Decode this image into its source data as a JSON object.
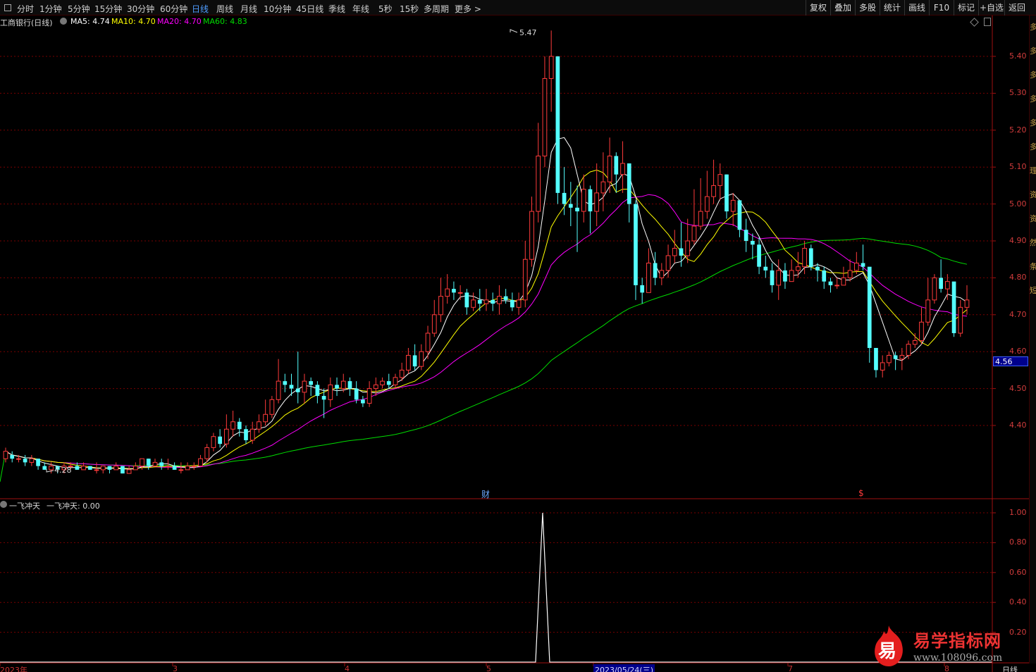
{
  "toolbar": {
    "periods": [
      {
        "label": "分时"
      },
      {
        "label": "1分钟"
      },
      {
        "label": "5分钟"
      },
      {
        "label": "15分钟"
      },
      {
        "label": "30分钟"
      },
      {
        "label": "60分钟"
      },
      {
        "label": "日线",
        "active": true
      },
      {
        "label": "周线"
      },
      {
        "label": "月线"
      },
      {
        "label": "10分钟"
      },
      {
        "label": "45日线"
      },
      {
        "label": "季线"
      },
      {
        "label": "年线"
      },
      {
        "label": "5秒"
      },
      {
        "label": "15秒"
      },
      {
        "label": "多周期"
      },
      {
        "label": "更多 >"
      }
    ],
    "right_buttons": [
      "复权",
      "叠加",
      "多股",
      "统计",
      "画线",
      "F10",
      "标记",
      "+自选",
      "返回"
    ]
  },
  "main_legend": {
    "title": "工商银行(日线)",
    "ma5": "MA5: 4.74",
    "ma10": "MA10: 4.70",
    "ma20": "MA20: 4.70",
    "ma60": "MA60: 4.83"
  },
  "indicator_legend": {
    "name": "一飞冲天",
    "value_text": "一飞冲天: 0.00"
  },
  "price_axis": [
    "5.40",
    "5.30",
    "5.20",
    "5.10",
    "5.00",
    "4.90",
    "4.80",
    "4.70",
    "4.60",
    "4.50",
    "4.40"
  ],
  "indicator_axis": [
    "1.00",
    "0.80",
    "0.60",
    "0.40",
    "0.20"
  ],
  "current_price_tag": "4.56",
  "high_marker": "5.47",
  "low_marker": "4.28",
  "event_markers": {
    "finance": "财",
    "dividend": "$"
  },
  "date_axis": [
    "2023年",
    "3",
    "4",
    "5",
    "2023/05/24(三)",
    "7",
    "8"
  ],
  "period_indicator": "日线",
  "sidebar_partial_text": "多多多多多多理资资然条短",
  "colors": {
    "up": "#ff3b3b",
    "down": "#54ffff",
    "ma5": "#ffffff",
    "ma10": "#ffff00",
    "ma20": "#ff00ff",
    "ma60": "#00dd00",
    "grid": "#7a0000",
    "axis_text": "#d23c3c"
  },
  "watermark": {
    "badge_char": "易",
    "title": "易学指标网",
    "url": "www.108096.com"
  },
  "chart_data": {
    "type": "candlestick",
    "series_names": [
      "MA5",
      "MA10",
      "MA20",
      "MA60"
    ],
    "ylim": [
      4.2,
      5.5
    ],
    "indicator_ylim": [
      0,
      1.05
    ],
    "indicator_peak": 1.0,
    "candles": [
      [
        4.31,
        4.33,
        4.34,
        4.3
      ],
      [
        4.32,
        4.31,
        4.33,
        4.3
      ],
      [
        4.31,
        4.31,
        4.32,
        4.3
      ],
      [
        4.31,
        4.3,
        4.32,
        4.29
      ],
      [
        4.3,
        4.31,
        4.32,
        4.29
      ],
      [
        4.31,
        4.29,
        4.31,
        4.28
      ],
      [
        4.29,
        4.28,
        4.3,
        4.28
      ],
      [
        4.28,
        4.29,
        4.3,
        4.27
      ],
      [
        4.29,
        4.28,
        4.29,
        4.27
      ],
      [
        4.28,
        4.29,
        4.3,
        4.27
      ],
      [
        4.29,
        4.29,
        4.3,
        4.28
      ],
      [
        4.29,
        4.28,
        4.3,
        4.28
      ],
      [
        4.28,
        4.29,
        4.3,
        4.28
      ],
      [
        4.29,
        4.28,
        4.29,
        4.28
      ],
      [
        4.28,
        4.28,
        4.3,
        4.27
      ],
      [
        4.28,
        4.29,
        4.29,
        4.27
      ],
      [
        4.29,
        4.28,
        4.29,
        4.27
      ],
      [
        4.28,
        4.29,
        4.3,
        4.28
      ],
      [
        4.29,
        4.27,
        4.29,
        4.27
      ],
      [
        4.27,
        4.28,
        4.29,
        4.27
      ],
      [
        4.28,
        4.29,
        4.3,
        4.28
      ],
      [
        4.29,
        4.31,
        4.31,
        4.28
      ],
      [
        4.31,
        4.29,
        4.31,
        4.28
      ],
      [
        4.29,
        4.3,
        4.31,
        4.29
      ],
      [
        4.3,
        4.29,
        4.31,
        4.28
      ],
      [
        4.29,
        4.29,
        4.31,
        4.28
      ],
      [
        4.29,
        4.28,
        4.3,
        4.28
      ],
      [
        4.28,
        4.28,
        4.3,
        4.27
      ],
      [
        4.28,
        4.29,
        4.3,
        4.28
      ],
      [
        4.29,
        4.29,
        4.3,
        4.28
      ],
      [
        4.29,
        4.31,
        4.32,
        4.29
      ],
      [
        4.31,
        4.34,
        4.35,
        4.3
      ],
      [
        4.34,
        4.37,
        4.38,
        4.33
      ],
      [
        4.37,
        4.35,
        4.39,
        4.34
      ],
      [
        4.35,
        4.39,
        4.43,
        4.34
      ],
      [
        4.39,
        4.41,
        4.44,
        4.37
      ],
      [
        4.41,
        4.39,
        4.42,
        4.37
      ],
      [
        4.39,
        4.36,
        4.4,
        4.35
      ],
      [
        4.36,
        4.39,
        4.41,
        4.35
      ],
      [
        4.39,
        4.41,
        4.43,
        4.38
      ],
      [
        4.41,
        4.43,
        4.47,
        4.4
      ],
      [
        4.43,
        4.47,
        4.48,
        4.42
      ],
      [
        4.47,
        4.52,
        4.58,
        4.46
      ],
      [
        4.52,
        4.51,
        4.54,
        4.49
      ],
      [
        4.51,
        4.5,
        4.54,
        4.48
      ],
      [
        4.5,
        4.49,
        4.6,
        4.46
      ],
      [
        4.49,
        4.52,
        4.54,
        4.46
      ],
      [
        4.52,
        4.51,
        4.53,
        4.48
      ],
      [
        4.51,
        4.48,
        4.52,
        4.46
      ],
      [
        4.48,
        4.47,
        4.5,
        4.42
      ],
      [
        4.47,
        4.51,
        4.53,
        4.45
      ],
      [
        4.51,
        4.5,
        4.53,
        4.48
      ],
      [
        4.5,
        4.52,
        4.54,
        4.49
      ],
      [
        4.52,
        4.5,
        4.53,
        4.48
      ],
      [
        4.5,
        4.47,
        4.52,
        4.46
      ],
      [
        4.47,
        4.46,
        4.48,
        4.45
      ],
      [
        4.46,
        4.5,
        4.52,
        4.45
      ],
      [
        4.5,
        4.51,
        4.53,
        4.48
      ],
      [
        4.51,
        4.52,
        4.53,
        4.5
      ],
      [
        4.52,
        4.51,
        4.54,
        4.5
      ],
      [
        4.51,
        4.53,
        4.54,
        4.5
      ],
      [
        4.53,
        4.55,
        4.57,
        4.52
      ],
      [
        4.55,
        4.59,
        4.61,
        4.54
      ],
      [
        4.59,
        4.56,
        4.62,
        4.55
      ],
      [
        4.56,
        4.6,
        4.62,
        4.55
      ],
      [
        4.6,
        4.65,
        4.67,
        4.58
      ],
      [
        4.65,
        4.7,
        4.74,
        4.64
      ],
      [
        4.7,
        4.75,
        4.8,
        4.68
      ],
      [
        4.75,
        4.77,
        4.81,
        4.73
      ],
      [
        4.77,
        4.76,
        4.79,
        4.74
      ],
      [
        4.76,
        4.76,
        4.78,
        4.74
      ],
      [
        4.76,
        4.72,
        4.77,
        4.7
      ],
      [
        4.72,
        4.74,
        4.76,
        4.71
      ],
      [
        4.74,
        4.73,
        4.77,
        4.71
      ],
      [
        4.73,
        4.74,
        4.77,
        4.71
      ],
      [
        4.74,
        4.73,
        4.76,
        4.71
      ],
      [
        4.73,
        4.75,
        4.78,
        4.7
      ],
      [
        4.75,
        4.74,
        4.77,
        4.73
      ],
      [
        4.74,
        4.72,
        4.76,
        4.71
      ],
      [
        4.72,
        4.74,
        4.76,
        4.7
      ],
      [
        4.74,
        4.85,
        4.9,
        4.72
      ],
      [
        4.85,
        4.98,
        5.02,
        4.83
      ],
      [
        4.98,
        5.13,
        5.22,
        4.95
      ],
      [
        5.13,
        5.34,
        5.4,
        5.1
      ],
      [
        5.34,
        5.4,
        5.47,
        5.25
      ],
      [
        5.4,
        5.03,
        5.39,
        5.0
      ],
      [
        5.03,
        5.0,
        5.1,
        4.97
      ],
      [
        5.0,
        4.99,
        5.06,
        4.94
      ],
      [
        4.99,
        4.98,
        5.05,
        4.87
      ],
      [
        4.98,
        5.04,
        5.08,
        4.95
      ],
      [
        5.04,
        4.98,
        5.05,
        4.92
      ],
      [
        4.98,
        5.03,
        5.11,
        4.94
      ],
      [
        5.03,
        5.06,
        5.14,
        4.98
      ],
      [
        5.06,
        5.13,
        5.18,
        5.03
      ],
      [
        5.13,
        5.08,
        5.14,
        5.03
      ],
      [
        5.08,
        5.11,
        5.17,
        5.03
      ],
      [
        5.11,
        5.0,
        5.11,
        4.95
      ],
      [
        5.0,
        4.78,
        5.01,
        4.74
      ],
      [
        4.78,
        4.76,
        4.8,
        4.73
      ],
      [
        4.76,
        4.84,
        4.88,
        4.76
      ],
      [
        4.84,
        4.8,
        4.87,
        4.78
      ],
      [
        4.8,
        4.82,
        4.84,
        4.78
      ],
      [
        4.82,
        4.86,
        4.89,
        4.8
      ],
      [
        4.86,
        4.88,
        4.93,
        4.84
      ],
      [
        4.88,
        4.86,
        4.95,
        4.83
      ],
      [
        4.86,
        4.9,
        4.96,
        4.84
      ],
      [
        4.9,
        4.94,
        5.04,
        4.89
      ],
      [
        4.94,
        4.98,
        5.07,
        4.93
      ],
      [
        4.98,
        5.02,
        5.09,
        4.96
      ],
      [
        5.02,
        5.05,
        5.12,
        5.0
      ],
      [
        5.05,
        5.08,
        5.11,
        5.01
      ],
      [
        5.08,
        4.98,
        5.08,
        4.96
      ],
      [
        4.98,
        5.01,
        5.03,
        4.94
      ],
      [
        5.01,
        4.93,
        5.01,
        4.91
      ],
      [
        4.93,
        4.9,
        4.96,
        4.87
      ],
      [
        4.9,
        4.89,
        4.92,
        4.85
      ],
      [
        4.89,
        4.83,
        4.91,
        4.81
      ],
      [
        4.83,
        4.82,
        4.86,
        4.8
      ],
      [
        4.82,
        4.78,
        4.84,
        4.76
      ],
      [
        4.78,
        4.82,
        4.85,
        4.74
      ],
      [
        4.82,
        4.79,
        4.84,
        4.77
      ],
      [
        4.79,
        4.82,
        4.85,
        4.79
      ],
      [
        4.82,
        4.83,
        4.87,
        4.8
      ],
      [
        4.83,
        4.88,
        4.9,
        4.81
      ],
      [
        4.88,
        4.83,
        4.89,
        4.82
      ],
      [
        4.83,
        4.82,
        4.84,
        4.79
      ],
      [
        4.82,
        4.79,
        4.83,
        4.77
      ],
      [
        4.79,
        4.78,
        4.8,
        4.76
      ],
      [
        4.78,
        4.78,
        4.8,
        4.77
      ],
      [
        4.78,
        4.8,
        4.83,
        4.78
      ],
      [
        4.8,
        4.82,
        4.85,
        4.79
      ],
      [
        4.82,
        4.84,
        4.87,
        4.81
      ],
      [
        4.84,
        4.83,
        4.89,
        4.82
      ],
      [
        4.83,
        4.61,
        4.62,
        4.57
      ],
      [
        4.61,
        4.55,
        4.59,
        4.53
      ],
      [
        4.55,
        4.57,
        4.59,
        4.53
      ],
      [
        4.57,
        4.59,
        4.6,
        4.56
      ],
      [
        4.59,
        4.58,
        4.6,
        4.55
      ],
      [
        4.58,
        4.59,
        4.61,
        4.55
      ],
      [
        4.59,
        4.62,
        4.63,
        4.58
      ],
      [
        4.62,
        4.63,
        4.65,
        4.61
      ],
      [
        4.63,
        4.68,
        4.72,
        4.62
      ],
      [
        4.68,
        4.74,
        4.8,
        4.67
      ],
      [
        4.74,
        4.8,
        4.81,
        4.73
      ],
      [
        4.8,
        4.77,
        4.85,
        4.76
      ],
      [
        4.77,
        4.79,
        4.81,
        4.74
      ],
      [
        4.79,
        4.65,
        4.76,
        4.64
      ],
      [
        4.65,
        4.72,
        4.74,
        4.64
      ],
      [
        4.72,
        4.74,
        4.78,
        4.7
      ]
    ]
  }
}
